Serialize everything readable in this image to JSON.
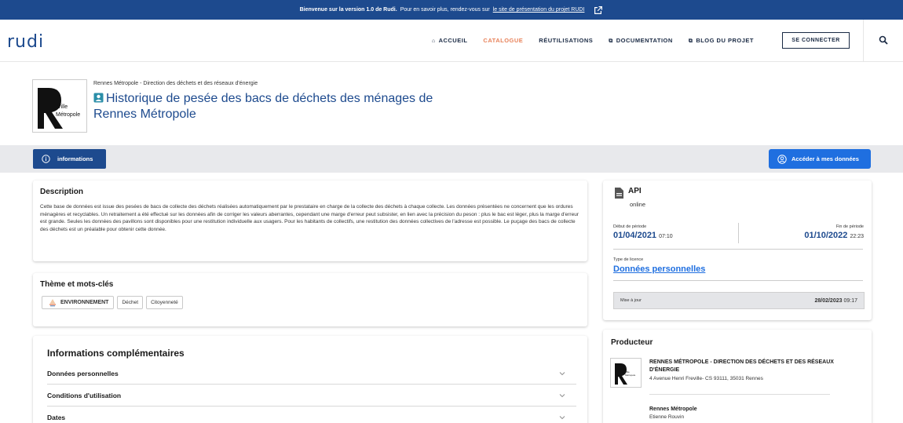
{
  "banner": {
    "text_bold": "Bienvenue sur la version 1.0 de Rudi.",
    "text": "Pour en savoir plus, rendez-vous sur",
    "link": "le site de présentation du projet RUDI"
  },
  "header": {
    "logo": "rudi",
    "nav": [
      {
        "label": "ACCUEIL",
        "icon": "home-icon"
      },
      {
        "label": "CATALOGUE",
        "icon": ""
      },
      {
        "label": "RÉUTILISATIONS",
        "icon": ""
      },
      {
        "label": "DOCUMENTATION",
        "icon": "external-link-icon"
      },
      {
        "label": "BLOG DU PROJET",
        "icon": "external-link-icon"
      }
    ],
    "connect": "SE CONNECTER",
    "colors": {
      "primary": "#1d4a8e",
      "active": "#e8825a",
      "accent": "#1f6fe0"
    }
  },
  "dataset": {
    "org": "Rennes Métropole - Direction des déchets et des réseaux d'énergie",
    "logo_text": [
      "Ville",
      "Métropole"
    ],
    "title": "Historique de pesée des bacs de déchets des ménages de Rennes Métropole"
  },
  "tabs": {
    "info": "informations",
    "access": "Accéder à mes données"
  },
  "description": {
    "title": "Description",
    "text": "Cette base de données est issue des pesées de bacs de collecte des déchets réalisées automatiquement par le prestataire en charge de la collecte des déchets à chaque collecte. Les données présentées ne concernent que les ordures ménagères et recyclables. Un retraitement a été effectué sur les données afin de corriger les valeurs aberrantes, cependant une marge d'erreur peut subsister, en lien avec la précision du peson : plus le bac est léger, plus la marge d'erreur est grande. Seules les données des pavillons sont disponibles pour une restitution individuelle aux usagers. Pour les habitants de collectifs, une restitution des données collectives de l'adresse est possible. Le puçage des bacs de collecte des déchets est un préalable pour obtenir cette donnée."
  },
  "theme": {
    "title": "Thème et mots-clés",
    "main_tag": "ENVIRONNEMENT",
    "tags": [
      "Déchet",
      "Citoyenneté"
    ]
  },
  "more_info": {
    "title": "Informations complémentaires",
    "rows": [
      "Données personnelles",
      "Conditions d'utilisation",
      "Dates"
    ]
  },
  "api": {
    "title": "API",
    "status": "online",
    "start_label": "Début de période",
    "start_date": "01/04/2021",
    "start_time": "07:10",
    "end_label": "Fin de période",
    "end_date": "01/10/2022",
    "end_time": "22:23",
    "licence_label": "Type de licence",
    "licence": "Données personnelles",
    "update_label": "Mise à jour",
    "update_date": "28/02/2023",
    "update_time": "09:17"
  },
  "producer": {
    "title": "Producteur",
    "name": "RENNES MÉTROPOLE - DIRECTION DES DÉCHETS ET DES RÉSEAUX D'ÉNERGIE",
    "address": "4 Avenue Henri Freville- CS 93111, 35031 Rennes",
    "contact_org": "Rennes Métropole",
    "contact_person": "Etienne Rouvin"
  }
}
